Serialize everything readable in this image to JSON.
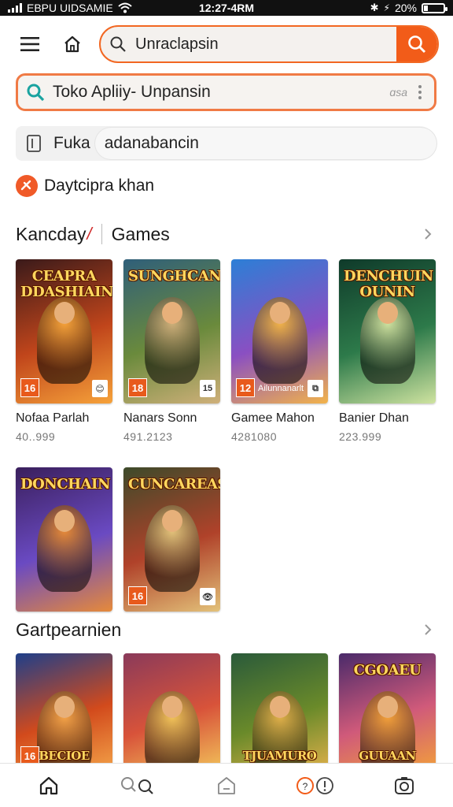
{
  "status_bar": {
    "carrier": "EBPU UIDSAMIE",
    "time": "12:27-4RM",
    "battery": "20%",
    "battery_level": 0.2
  },
  "top_bar": {
    "search_value": "Unraclapsin"
  },
  "second_search": {
    "value": "Toko Apliiy- Unpansin",
    "hint": "ɑsa"
  },
  "third_row": {
    "label": "Fuka",
    "value": "adanabancin"
  },
  "promo": {
    "label": "Daytcipra khan"
  },
  "section1": {
    "title_left": "Kancday",
    "title_right": "Games",
    "cards": [
      {
        "art": "CEAPRA DDASHIAIN",
        "name": "Nofaa Parlah",
        "sub": "40..999",
        "rating": "16",
        "pub": "😊",
        "strip": "",
        "palette": [
          "#3a1a1a",
          "#c0451b",
          "#f6a23a"
        ],
        "icon": "badge"
      },
      {
        "art": "SUNGHCAN",
        "name": "Nanars Sonn",
        "sub": "491.2123",
        "rating": "18",
        "pub": "15",
        "strip": "",
        "palette": [
          "#2f5f7a",
          "#6a8a3c",
          "#cfb07a"
        ],
        "icon": "badge"
      },
      {
        "art": "",
        "name": "Gamee Mahon",
        "sub": "4281080",
        "rating": "12",
        "pub": "⧉",
        "strip": "Ailunnanarlt",
        "palette": [
          "#2c7fd6",
          "#8a4fc2",
          "#f2b34a"
        ],
        "icon": "badge"
      },
      {
        "art": "DENCHUIN OUNIN",
        "name": "Banier Dhan",
        "sub": "223.999",
        "rating": "",
        "pub": "",
        "strip": "",
        "palette": [
          "#0f3a2a",
          "#2d7a4a",
          "#cfe3a0"
        ],
        "icon": "none"
      }
    ],
    "cards_row2": [
      {
        "art": "DONCHAIN",
        "name": "",
        "sub": "",
        "rating": "",
        "pub": "",
        "strip": "",
        "palette": [
          "#3a1f5c",
          "#6a4ac2",
          "#e68a3a"
        ],
        "icon": "none"
      },
      {
        "art": "CUNCAREAS",
        "name": "",
        "sub": "",
        "rating": "16",
        "pub": "👁",
        "strip": "",
        "palette": [
          "#3d4a2a",
          "#b0422a",
          "#e3c27a"
        ],
        "icon": "badge"
      }
    ]
  },
  "section2": {
    "title": "Gartpearnien",
    "cards": [
      {
        "art": "",
        "bottom_art": "BECIOE",
        "rating": "16",
        "palette": [
          "#1e3f8a",
          "#d24a1c",
          "#f3a248"
        ]
      },
      {
        "art": "",
        "bottom_art": "",
        "rating": "",
        "palette": [
          "#8a3a5a",
          "#d8533a",
          "#f2c35a"
        ]
      },
      {
        "art": "",
        "bottom_art": "TJUAMURO",
        "rating": "",
        "palette": [
          "#2a5a3a",
          "#6a8a2a",
          "#e0b04a"
        ]
      },
      {
        "art": "CGOAEU",
        "bottom_art": "GUUAAN",
        "rating": "",
        "palette": [
          "#4a2a6a",
          "#d05a7a",
          "#f2a03a"
        ]
      }
    ]
  },
  "bottom_nav": {
    "items": [
      "home-icon",
      "search-icon",
      "store-icon",
      "notification-icon",
      "profile-icon"
    ]
  },
  "colors": {
    "accent": "#f25c19",
    "accent_border": "#f07a45"
  }
}
